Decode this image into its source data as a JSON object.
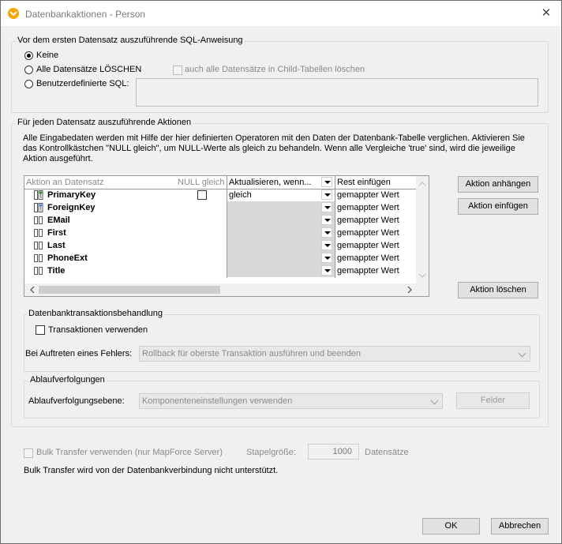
{
  "window": {
    "title": "Datenbankaktionen - Person",
    "close_glyph": "✕",
    "icon": "mapforce-app-icon"
  },
  "pre_sql": {
    "legend": "Vor dem ersten Datensatz auszuführende SQL-Anweisung",
    "options": [
      "Keine",
      "Alle Datensätze LÖSCHEN",
      "Benutzerdefinierte SQL:"
    ],
    "selected": "Keine",
    "child_delete_label": "auch alle Datensätze in Child-Tabellen löschen",
    "custom_sql_value": ""
  },
  "actions": {
    "legend": "Für jeden Datensatz auszuführende Aktionen",
    "description": "Alle Eingabedaten werden mit Hilfe der hier definierten Operatoren mit den Daten der Datenbank-Tabelle verglichen. Aktivieren Sie das Kontrollkästchen \"NULL gleich\", um NULL-Werte als gleich zu behandeln. Wenn alle Vergleiche 'true' sind, wird die jeweilige Aktion ausgeführt.",
    "columns": {
      "field": "Aktion an Datensatz",
      "null_equal": "NULL gleich",
      "update_if": "Aktualisieren, wenn...",
      "insert_rest": "Rest einfügen"
    },
    "rows": [
      {
        "name": "PrimaryKey",
        "icon": "primary-key-icon",
        "null_checkbox": true,
        "update": "gleich",
        "rest": "gemappter Wert"
      },
      {
        "name": "ForeignKey",
        "icon": "foreign-key-icon",
        "null_checkbox": false,
        "update": "",
        "rest": "gemappter Wert"
      },
      {
        "name": "EMail",
        "icon": "field-icon",
        "null_checkbox": false,
        "update": "",
        "rest": "gemappter Wert"
      },
      {
        "name": "First",
        "icon": "field-icon",
        "null_checkbox": false,
        "update": "",
        "rest": "gemappter Wert"
      },
      {
        "name": "Last",
        "icon": "field-icon",
        "null_checkbox": false,
        "update": "",
        "rest": "gemappter Wert"
      },
      {
        "name": "PhoneExt",
        "icon": "field-icon",
        "null_checkbox": false,
        "update": "",
        "rest": "gemappter Wert"
      },
      {
        "name": "Title",
        "icon": "field-icon",
        "null_checkbox": false,
        "update": "",
        "rest": "gemappter Wert"
      }
    ],
    "buttons": {
      "append": "Aktion anhängen",
      "insert": "Aktion einfügen",
      "delete": "Aktion löschen"
    }
  },
  "transactions": {
    "legend": "Datenbanktransaktionsbehandlung",
    "use_label": "Transaktionen verwenden",
    "error_label": "Bei Auftreten eines Fehlers:",
    "error_value": "Rollback für oberste Transaktion ausführen und beenden"
  },
  "tracing": {
    "legend": "Ablaufverfolgungen",
    "level_label": "Ablaufverfolgungsebene:",
    "level_value": "Komponenteneinstellungen verwenden",
    "fields_button": "Felder"
  },
  "bulk": {
    "label": "Bulk Transfer verwenden (nur MapForce Server)",
    "batch_label": "Stapelgröße:",
    "batch_value": "1000",
    "batch_unit": "Datensätze",
    "note": "Bulk Transfer wird von der Datenbankverbindung nicht unterstützt."
  },
  "footer": {
    "ok": "OK",
    "cancel": "Abbrechen"
  },
  "colors": {
    "dialog_bg": "#f0f0f0",
    "app_icon": "#f2a400",
    "key_green": "#3a9a3a"
  }
}
